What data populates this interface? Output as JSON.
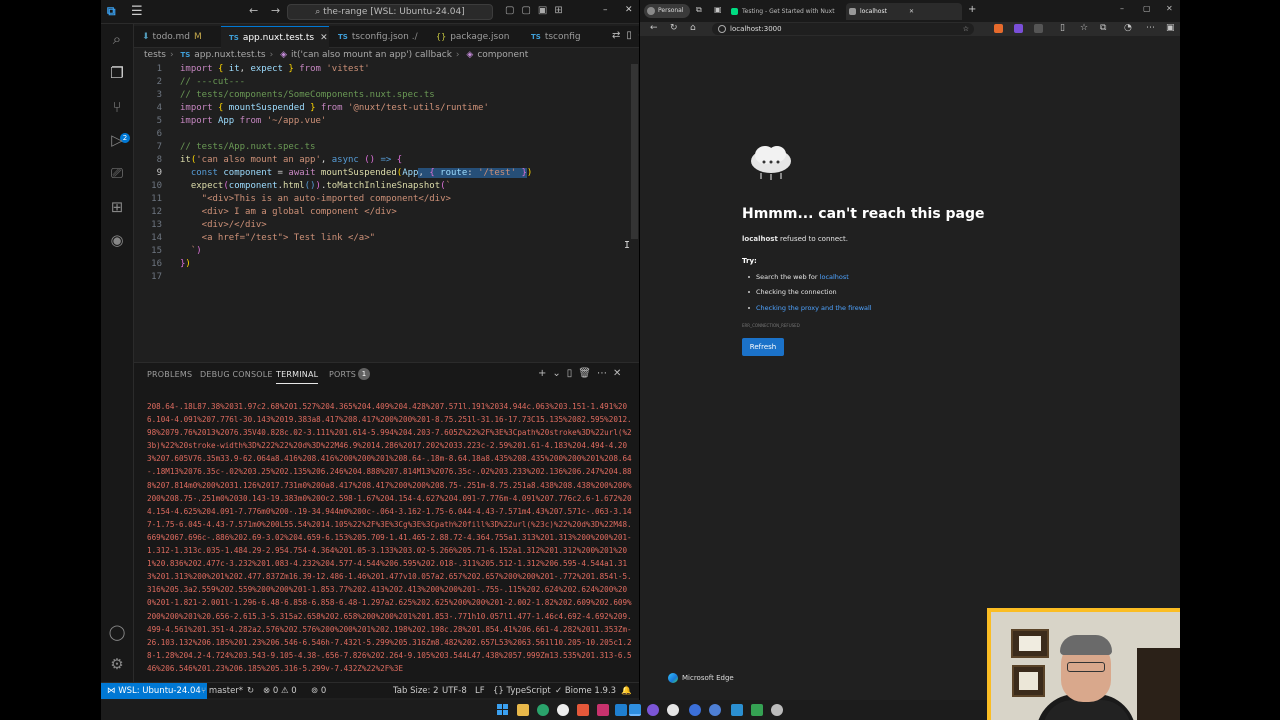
{
  "vscode": {
    "title": "the-range [WSL: Ubuntu-24.04]",
    "tabs": [
      {
        "label": "todo.md",
        "badge": "M"
      },
      {
        "label": "app.nuxt.test.ts",
        "badge": ""
      },
      {
        "label": "tsconfig.json",
        "badge": "./"
      },
      {
        "label": "package.json",
        "badge": ""
      },
      {
        "label": "tsconfig",
        "badge": ""
      }
    ],
    "breadcrumb": [
      "tests",
      "app.nuxt.test.ts",
      "it('can also mount an app') callback",
      "component"
    ],
    "code_lines": [
      "import { it, expect } from 'vitest'",
      "// ---cut---",
      "// tests/components/SomeComponents.nuxt.spec.ts",
      "import { mountSuspended } from '@nuxt/test-utils/runtime'",
      "import App from '~/app.vue'",
      "",
      "// tests/App.nuxt.spec.ts",
      "it('can also mount an app', async () => {",
      "  const component = await mountSuspended(App, { route: '/test' })",
      "  expect(component.html()).toMatchInlineSnapshot(`",
      "    \"<div>This is an auto-imported component</div>",
      "    <div> I am a global component </div>",
      "    <div>/</div>",
      "    <a href=\"/test\"> Test link </a>\"",
      "  `)",
      "})",
      ""
    ],
    "line_numbers": [
      "1",
      "2",
      "3",
      "4",
      "5",
      "6",
      "7",
      "8",
      "9",
      "10",
      "11",
      "12",
      "13",
      "14",
      "15",
      "16",
      "17"
    ],
    "panel": {
      "tabs": [
        "PROBLEMS",
        "DEBUG CONSOLE",
        "TERMINAL",
        "PORTS"
      ],
      "ports_badge": "1",
      "terminal_text": "208.64-.18L87.38%2031.97c2.68%201.527%204.365%204.409%204.428%207.571l.191%2034.944c.063%203.151-1.491%206.104-4.091%207.776l-30.143%2019.383a8.417%208.417%200%200%201-8.75.251l-31.16-17.73C15.135%2082.595%2012.98%2079.76%2013%2076.35V40.828c.02-3.111%201.614-5.994%204.203-7.605Z%22%2F%3E%3Cpath%20stroke%3D%22url(%23b)%22%20stroke-width%3D%222%22%20d%3D%22M46.9%2014.286%2017.202%2033.223c-2.59%201.61-4.183%204.494-4.203%207.605V76.35m33.9-62.064a8.416%208.416%200%200%201%208.64-.18m-8.64.18a8.435%208.435%200%200%201%208.64-.18M13%2076.35c-.02%203.25%202.135%206.246%204.888%207.814M13%2076.35c-.02%203.233%202.136%206.247%204.888%207.814m0%200%2031.126%2017.731m0%200a8.417%208.417%200%200%208.75-.251m-8.75.251a8.438%208.438%200%200%200%208.75-.251m0%2030.143-19.383m0%200c2.598-1.67%204.154-4.627%204.091-7.776m-4.091%207.776c2.6-1.672%204.154-4.625%204.091-7.776m0%200-.19-34.944m0%200c-.064-3.162-1.75-6.044-4.43-7.571m4.43%207.571c-.063-3.147-1.75-6.045-4.43-7.571m0%200L55.54%2014.105%22%2F%3E%3Cg%3E%3Cpath%20fill%3D%22url(%23c)%22%20d%3D%22M48.669%2067.696c-.886%202.69-3.02%204.659-6.153%205.709-1.41.465-2.88.72-4.364.755a1.313%201.313%200%200%201-1.312-1.313c.035-1.484.29-2.954.754-4.364%201.05-3.133%203.02-5.266%205.71-6.152a1.312%201.312%200%201%201%20.836%202.477c-3.232%201.083-4.232%204.577-4.544%206.595%202.018-.311%205.512-1.312%206.595-4.544a1.313%201.313%200%201%202.477.837Zm16.39-12.486-1.46%201.477v10.057a2.657%202.657%200%200%201-.772%201.854l-5.316%205.3a2.559%202.559%200%200%201-1.853.77%202.413%202.413%200%200%201-.755-.115%202.624%202.624%200%200%201-1.821-2.001l-1.296-6.48-6.858-6.858-6.48-1.297a2.625%202.625%200%200%201-2.002-1.82%202.609%202.609%200%200%201%20.656-2.615.3-5.315a2.658%202.658%200%200%201%201.853-.771h10.057l1.477-1.46c4.692-4.692%209.499-4.561%201.351-4.282a2.576%202.576%200%200%201%202.198%202.198c.28%201.854.41%206.661-4.282%2011.353Zm-26.103.132%206.185%201.23%206.546-6.546h-7.432l-5.299%205.316Zm8.482%202.657L53%2063.561l10.205-10.205c1.28-1.28%204.2-4.724%203.543-9.105-4.38-.656-7.826%202.264-9.105%203.544L47.438%2057.999Zm13.535%201.313-6.546%206.546%201.23%206.185%205.316-5.299v-7.432Z%22%2F%3E"
    },
    "status": {
      "remote": "WSL: Ubuntu-24.04",
      "branch": "master*",
      "sync": "",
      "errors": "0",
      "warnings": "0",
      "ports": "0",
      "tab_size": "Tab Size: 2",
      "encoding": "UTF-8",
      "eol": "LF",
      "language": "TypeScript",
      "formatter": "Biome 1.9.3"
    }
  },
  "edge": {
    "profile": "Personal",
    "tabs": [
      {
        "label": "Testing - Get Started with Nuxt",
        "color": "#00dc82"
      },
      {
        "label": "localhost",
        "color": "#cccccc"
      }
    ],
    "address": "localhost:3000",
    "error_title": "Hmmm... can't reach this page",
    "error_host": "localhost",
    "error_sub": " refused to connect.",
    "try_label": "Try:",
    "try_items": [
      "Search the web for ",
      "Checking the connection",
      "Checking the proxy and the firewall"
    ],
    "try_link": "localhost",
    "error_code": "ERR_CONNECTION_REFUSED",
    "refresh_label": "Refresh",
    "footer": "Microsoft Edge"
  },
  "colors": {
    "accent": "#0078d4",
    "terminal_text": "#e06c60",
    "webcam_border": "#fbbd23",
    "link": "#4ea3ff"
  }
}
